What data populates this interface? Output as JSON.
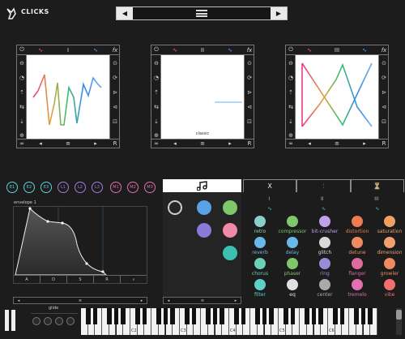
{
  "app": {
    "name": "CLICKS"
  },
  "preset_bar": {
    "prev_label": "◀",
    "next_label": "▶"
  },
  "oscillators": [
    {
      "id": "osc1",
      "mode_label": "I",
      "view_label": ""
    },
    {
      "id": "osc2",
      "mode_label": "II",
      "view_label": "classic"
    },
    {
      "id": "osc3",
      "mode_label": "III",
      "view_label": ""
    }
  ],
  "osc_side_icons": {
    "fx": "fx"
  },
  "mod_sources": [
    {
      "label": "E1",
      "color": "#5fd0e0"
    },
    {
      "label": "E2",
      "color": "#5fd0e0"
    },
    {
      "label": "E3",
      "color": "#5fd0e0"
    },
    {
      "label": "L1",
      "color": "#a07de0"
    },
    {
      "label": "L2",
      "color": "#a07de0"
    },
    {
      "label": "L3",
      "color": "#a07de0"
    },
    {
      "label": "M1",
      "color": "#e070b0"
    },
    {
      "label": "M2",
      "color": "#e070b0"
    },
    {
      "label": "M3",
      "color": "#e070b0"
    }
  ],
  "envelope": {
    "label": "envelope 1",
    "tabs": [
      "A",
      "D",
      "S",
      "R"
    ]
  },
  "fx_tabs": [
    "X",
    "",
    ""
  ],
  "fx_row_labels": [
    "I",
    "II",
    "III"
  ],
  "fx_items": [
    {
      "label": "retro",
      "color": "#8ad0c8"
    },
    {
      "label": "compressor",
      "color": "#7ec86a"
    },
    {
      "label": "bit-crusher",
      "color": "#c0a0e8"
    },
    {
      "label": "distortion",
      "color": "#f07a52"
    },
    {
      "label": "saturation",
      "color": "#f0a060"
    },
    {
      "label": "reverb",
      "color": "#6ab8e8"
    },
    {
      "label": "delay",
      "color": "#6ab8e8"
    },
    {
      "label": "glitch",
      "color": "#d8d8d8"
    },
    {
      "label": "detune",
      "color": "#f08a60"
    },
    {
      "label": "dimension",
      "color": "#f0a070"
    },
    {
      "label": "chorus",
      "color": "#6ad0b8"
    },
    {
      "label": "phaser",
      "color": "#7ec86a"
    },
    {
      "label": "ring",
      "color": "#9a8ad8"
    },
    {
      "label": "flanger",
      "color": "#e06aa0"
    },
    {
      "label": "growler",
      "color": "#f08a60"
    },
    {
      "label": "filter",
      "color": "#5fd0c8"
    },
    {
      "label": "eq",
      "color": "#e0e0e0"
    },
    {
      "label": "center",
      "color": "#aaaaaa"
    },
    {
      "label": "tremelo",
      "color": "#e070b0"
    },
    {
      "label": "vibe",
      "color": "#f07070"
    }
  ],
  "performance": {
    "glide_label": "glide",
    "knob_labels": [
      "",
      "",
      "",
      ""
    ]
  },
  "keyboard": {
    "octaves": [
      "C2",
      "C3",
      "C4",
      "C5",
      "C6"
    ]
  }
}
